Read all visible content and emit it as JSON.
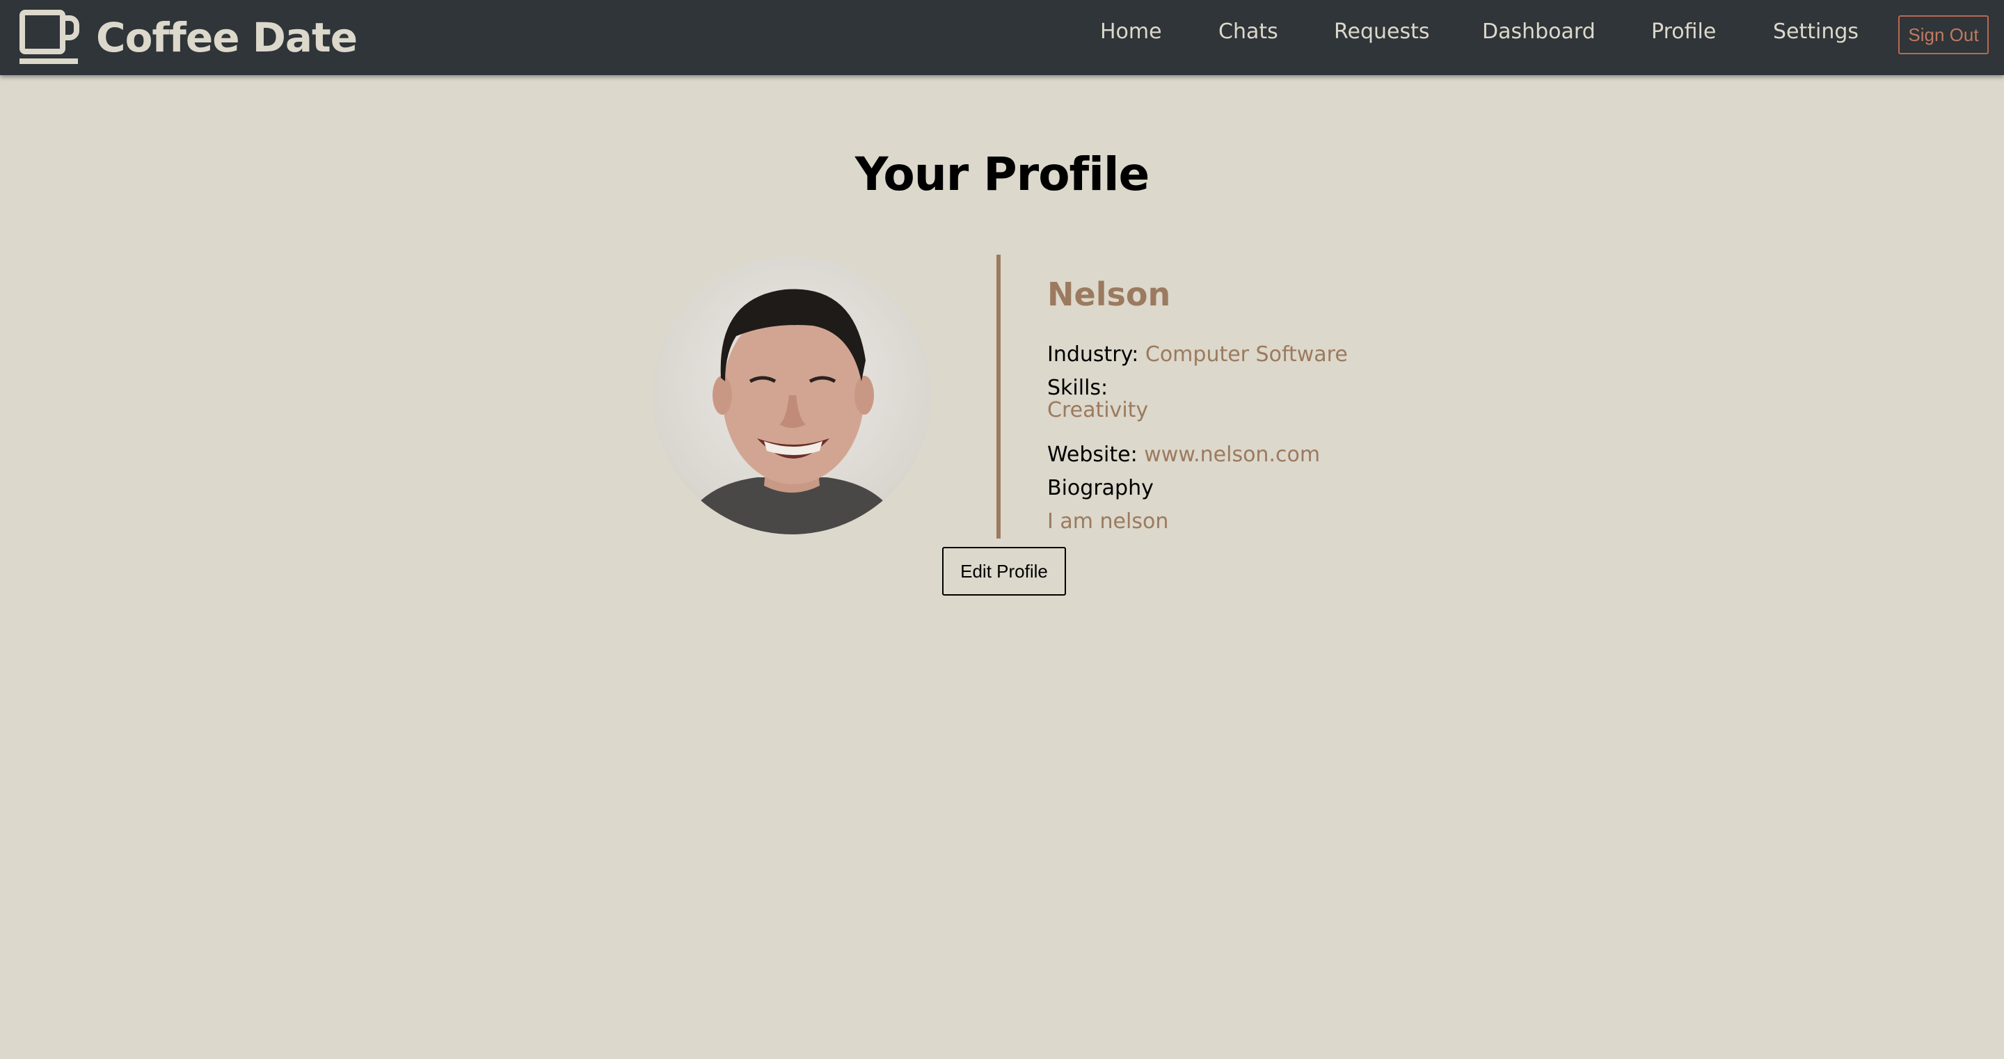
{
  "brand": {
    "title": "Coffee Date",
    "icon": "coffee-cup-icon"
  },
  "nav": {
    "items": [
      {
        "label": "Home"
      },
      {
        "label": "Chats"
      },
      {
        "label": "Requests"
      },
      {
        "label": "Dashboard"
      },
      {
        "label": "Profile"
      },
      {
        "label": "Settings"
      }
    ],
    "sign_out": "Sign Out"
  },
  "page": {
    "title": "Your Profile"
  },
  "profile": {
    "name": "Nelson",
    "industry_label": "Industry:",
    "industry": "Computer Software",
    "skills_label": "Skills:",
    "skills": [
      "Creativity"
    ],
    "website_label": "Website:",
    "website": "www.nelson.com",
    "bio_label": "Biography",
    "bio": "I am nelson"
  },
  "actions": {
    "edit_profile": "Edit Profile"
  },
  "colors": {
    "navbar": "#2f3538",
    "background": "#dcd8cb",
    "accent": "#9b7a5f",
    "sign_out": "#b86a54"
  }
}
